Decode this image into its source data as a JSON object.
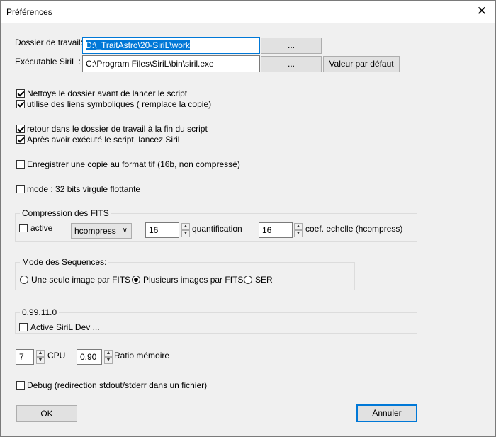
{
  "window": {
    "title": "Préférences",
    "close_glyph": "✕"
  },
  "paths": {
    "workdir_label": "Dossier de travail:",
    "workdir_value": "D:\\_TraitAstro\\20-SiriL\\work",
    "workdir_browse": "...",
    "exe_label": "Exécutable SiriL :",
    "exe_value": "C:\\Program Files\\SiriL\\bin\\siril.exe",
    "exe_browse": "...",
    "default_button": "Valeur par défaut"
  },
  "options": {
    "clean_dir": "Nettoye le  dossier avant de  lancer le script",
    "symlinks": "utilise des liens symboliques ( remplace la copie)",
    "return_dir": "retour dans le dossier de travail à la fin du script",
    "launch_siril": "Après avoir exécuté le script, lancez Siril",
    "save_tif": "Enregistrer une copie au format tif (16b, non compressé)",
    "mode32": "mode : 32 bits virgule flottante"
  },
  "compression": {
    "title": "Compression des FITS",
    "active_label": "active",
    "method": "hcompress",
    "quant_value": "16",
    "quant_label": "quantification",
    "scale_value": "16",
    "scale_label": "coef. echelle (hcompress)"
  },
  "sequences": {
    "title": "Mode des Sequences:",
    "opt1": "Une seule image par FITS",
    "opt2": "Plusieurs images par FITS",
    "opt3": "SER"
  },
  "dev": {
    "version": "0.99.11.0",
    "label": "Active SiriL Dev ..."
  },
  "perf": {
    "cpu_value": "7",
    "cpu_label": "CPU",
    "ratio_value": "0.90",
    "ratio_label": "Ratio mémoire"
  },
  "debug_label": "Debug (redirection stdout/stderr dans un fichier)",
  "footer": {
    "ok": "OK",
    "cancel": "Annuler"
  },
  "colors": {
    "accent": "#0078d7",
    "dialog_bg": "#f0f0f0"
  }
}
